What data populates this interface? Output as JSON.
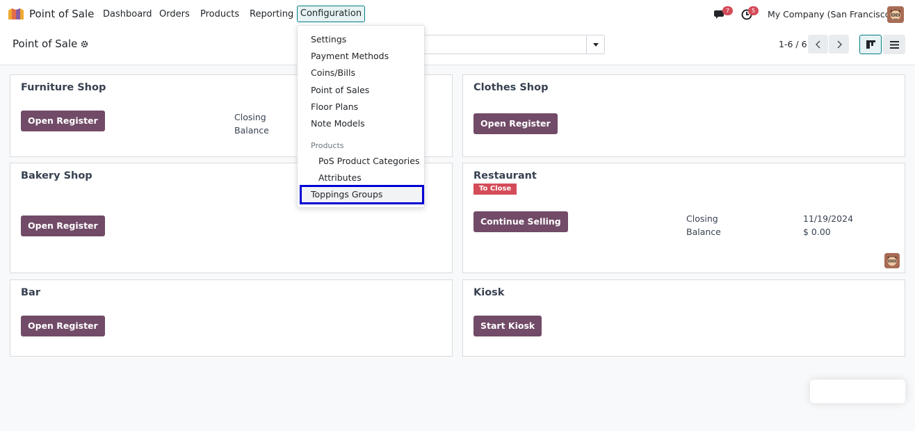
{
  "navbar": {
    "app_name": "Point of Sale",
    "menu": [
      "Dashboard",
      "Orders",
      "Products",
      "Reporting"
    ],
    "active_menu": "Configuration",
    "messages_count": "7",
    "activities_count": "5",
    "company": "My Company (San Francisco)"
  },
  "control_panel": {
    "breadcrumb": "Point of Sale",
    "pager": "1-6 / 6"
  },
  "dropdown": {
    "items": [
      "Settings",
      "Payment Methods",
      "Coins/Bills",
      "Point of Sales",
      "Floor Plans",
      "Note Models"
    ],
    "section_header": "Products",
    "sub_items": [
      "PoS Product Categories",
      "Attributes",
      "Toppings Groups"
    ]
  },
  "cards": {
    "furniture": {
      "title": "Furniture Shop",
      "button": "Open Register",
      "closing_label": "Closing",
      "balance_label": "Balance"
    },
    "clothes": {
      "title": "Clothes Shop",
      "button": "Open Register"
    },
    "bakery": {
      "title": "Bakery Shop",
      "button": "Open Register"
    },
    "restaurant": {
      "title": "Restaurant",
      "badge": "To Close",
      "button": "Continue Selling",
      "closing_label": "Closing",
      "balance_label": "Balance",
      "closing_value": "11/19/2024",
      "balance_value": "$ 0.00"
    },
    "bar": {
      "title": "Bar",
      "button": "Open Register"
    },
    "kiosk": {
      "title": "Kiosk",
      "button": "Start Kiosk"
    }
  },
  "colors": {
    "primary": "#714b67",
    "accent": "#017e84",
    "badge": "#d44c59",
    "highlight_border": "#0000d4"
  }
}
